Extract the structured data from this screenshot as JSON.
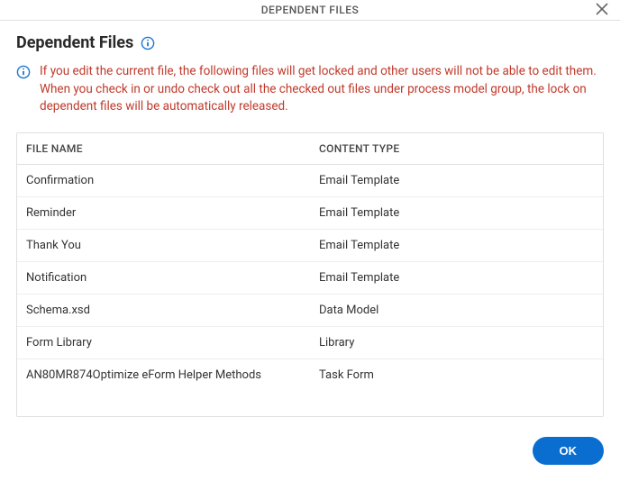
{
  "titlebar": {
    "title": "DEPENDENT FILES"
  },
  "heading": "Dependent Files",
  "warning": "If you edit the current file, the following files will get locked and other users will not be able to edit them. When you check in or undo check out all the checked out files under process model group, the lock on dependent files will be automatically released.",
  "table": {
    "columns": {
      "file_name": "FILE NAME",
      "content_type": "CONTENT TYPE"
    },
    "rows": [
      {
        "file_name": "Confirmation",
        "content_type": "Email Template"
      },
      {
        "file_name": "Reminder",
        "content_type": "Email Template"
      },
      {
        "file_name": "Thank You",
        "content_type": "Email Template"
      },
      {
        "file_name": "Notification",
        "content_type": "Email Template"
      },
      {
        "file_name": "Schema.xsd",
        "content_type": "Data Model"
      },
      {
        "file_name": "Form Library",
        "content_type": "Library"
      },
      {
        "file_name": "AN80MR874Optimize eForm Helper Methods",
        "content_type": "Task Form"
      }
    ]
  },
  "footer": {
    "ok_label": "OK"
  }
}
